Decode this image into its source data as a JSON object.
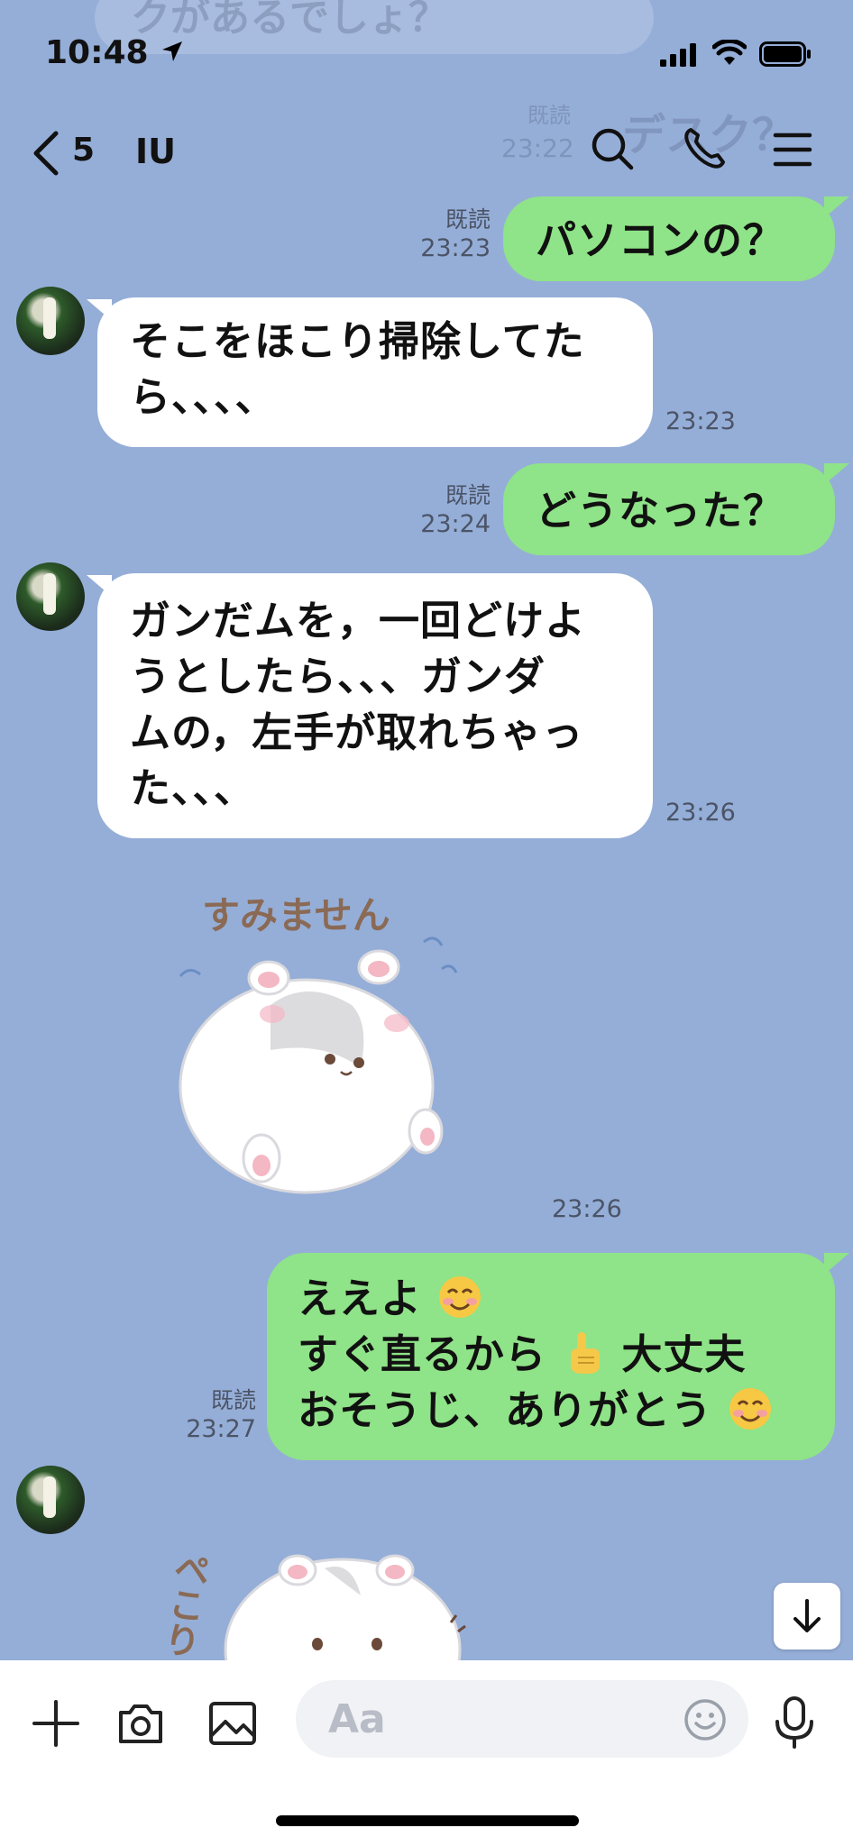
{
  "status_bar": {
    "time": "10:48"
  },
  "header": {
    "unread_count": "5",
    "title": "IU"
  },
  "background_ghost": {
    "text": "クがあるでしょ？",
    "text2": "デスク？",
    "read": "既読",
    "time": "23:22"
  },
  "messages": [
    {
      "dir": "out",
      "text": "パソコンの？",
      "read": "既読",
      "time": "23:23"
    },
    {
      "dir": "in",
      "lines": [
        "そこをほこり掃除してた",
        "ら、、、、"
      ],
      "time": "23:23"
    },
    {
      "dir": "out",
      "text": "どうなった？",
      "read": "既読",
      "time": "23:24"
    },
    {
      "dir": "in",
      "lines": [
        "ガンだムを，一回どけよ",
        "うとしたら、、、ガンダ",
        "ムの，左手が取れちゃっ",
        "た、、、"
      ],
      "time": "23:26"
    },
    {
      "dir": "in",
      "type": "sticker",
      "caption": "すみません",
      "time": "23:26"
    },
    {
      "dir": "out",
      "lines": [
        "ええよ",
        "すぐ直るから",
        "大丈夫",
        "おそうじ、ありがとう"
      ],
      "read": "既読",
      "time": "23:27"
    },
    {
      "dir": "in",
      "type": "sticker",
      "caption": "ペこり"
    }
  ],
  "input": {
    "placeholder": "Aa"
  },
  "icons": {
    "location": "location-arrow-icon",
    "signal": "cellular-signal-icon",
    "wifi": "wifi-icon",
    "battery": "battery-icon",
    "back": "chevron-left-icon",
    "search": "search-icon",
    "call": "phone-icon",
    "menu": "menu-icon",
    "scroll": "arrow-down-icon",
    "plus": "plus-icon",
    "camera": "camera-icon",
    "image": "image-icon",
    "emoji": "smiley-icon",
    "mic": "microphone-icon"
  },
  "colors": {
    "background": "#95aed8",
    "bubble_out": "#8fe388",
    "bubble_in": "#ffffff"
  }
}
